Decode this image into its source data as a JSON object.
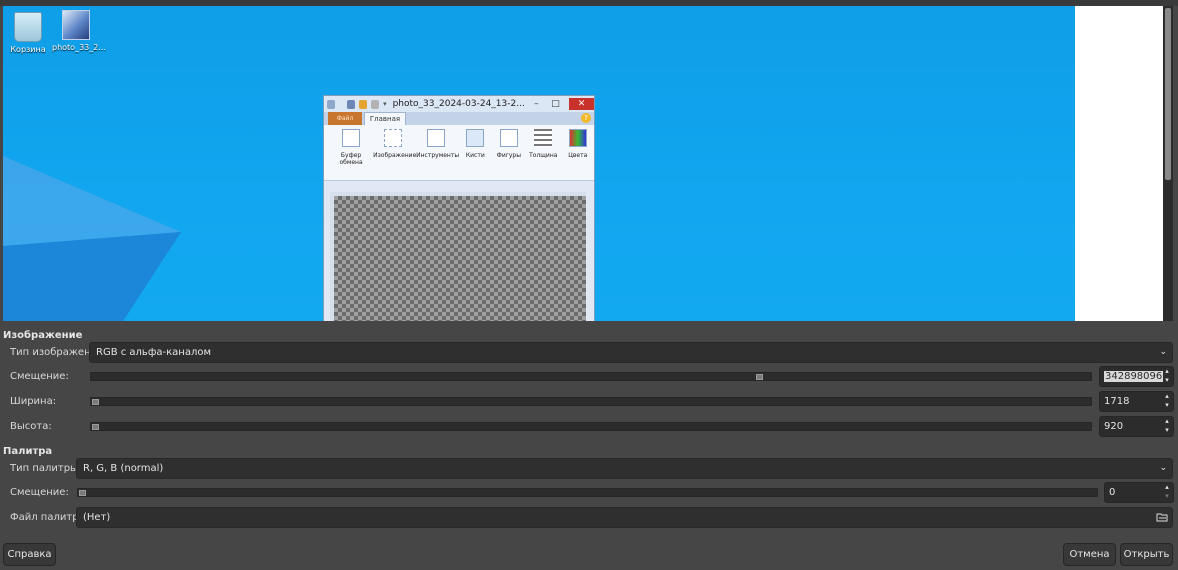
{
  "preview": {
    "desktop_icons": [
      {
        "label": "Корзина",
        "icon": "recycle-bin-icon"
      },
      {
        "label": "photo_33_2...",
        "icon": "photo-file-icon"
      }
    ],
    "paint_window": {
      "title": "photo_33_2024-03-24_13-2...",
      "ribbon_tabs": {
        "file": "Файл",
        "home": "Главная"
      },
      "ribbon_groups": [
        "Буфер обмена",
        "Изображение",
        "Инструменты",
        "Кисти",
        "Фигуры",
        "Толщина",
        "Цвета"
      ]
    }
  },
  "image_section": {
    "title": "Изображение",
    "type_label": "Тип изображения:",
    "type_value": "RGB с альфа-каналом",
    "offset_label": "Смещение:",
    "offset_value": "342898096",
    "offset_slider_fraction": 0.67,
    "width_label": "Ширина:",
    "width_value": "1718",
    "height_label": "Высота:",
    "height_value": "920"
  },
  "palette_section": {
    "title": "Палитра",
    "type_label": "Тип палитры:",
    "type_value": "R, G, B (normal)",
    "offset_label": "Смещение:",
    "offset_value": "0",
    "file_label": "Файл палитры:",
    "file_value": "(Нет)"
  },
  "buttons": {
    "help": "Справка",
    "cancel": "Отмена",
    "open": "Открыть"
  },
  "colors": {
    "dialog_bg": "#464646",
    "desktop_blue": "#11a6ef",
    "paint_close": "#c9312b"
  }
}
